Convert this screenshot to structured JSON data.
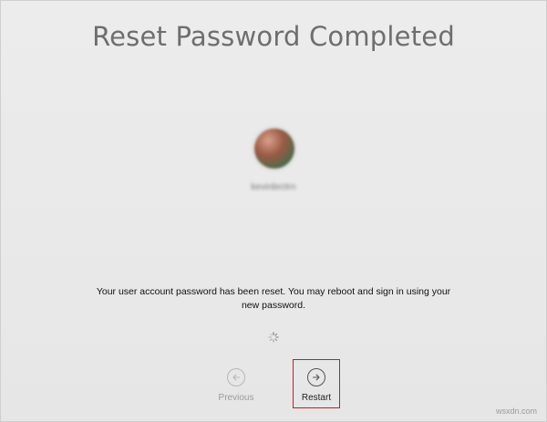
{
  "header": {
    "title": "Reset Password Completed"
  },
  "user": {
    "name": "kevinbrctrn"
  },
  "message": {
    "line1": "Your user account password has been reset. You may reboot and sign in using your",
    "line2": "new password."
  },
  "nav": {
    "previous_label": "Previous",
    "restart_label": "Restart"
  },
  "icons": {
    "previous": "arrow-left-circle-icon",
    "restart": "arrow-right-circle-icon",
    "spinner": "loading-spinner-icon"
  },
  "colors": {
    "highlight_border": "#c31f1f",
    "background": "#eaeaea"
  },
  "footer": {
    "watermark": "wsxdn.com"
  }
}
